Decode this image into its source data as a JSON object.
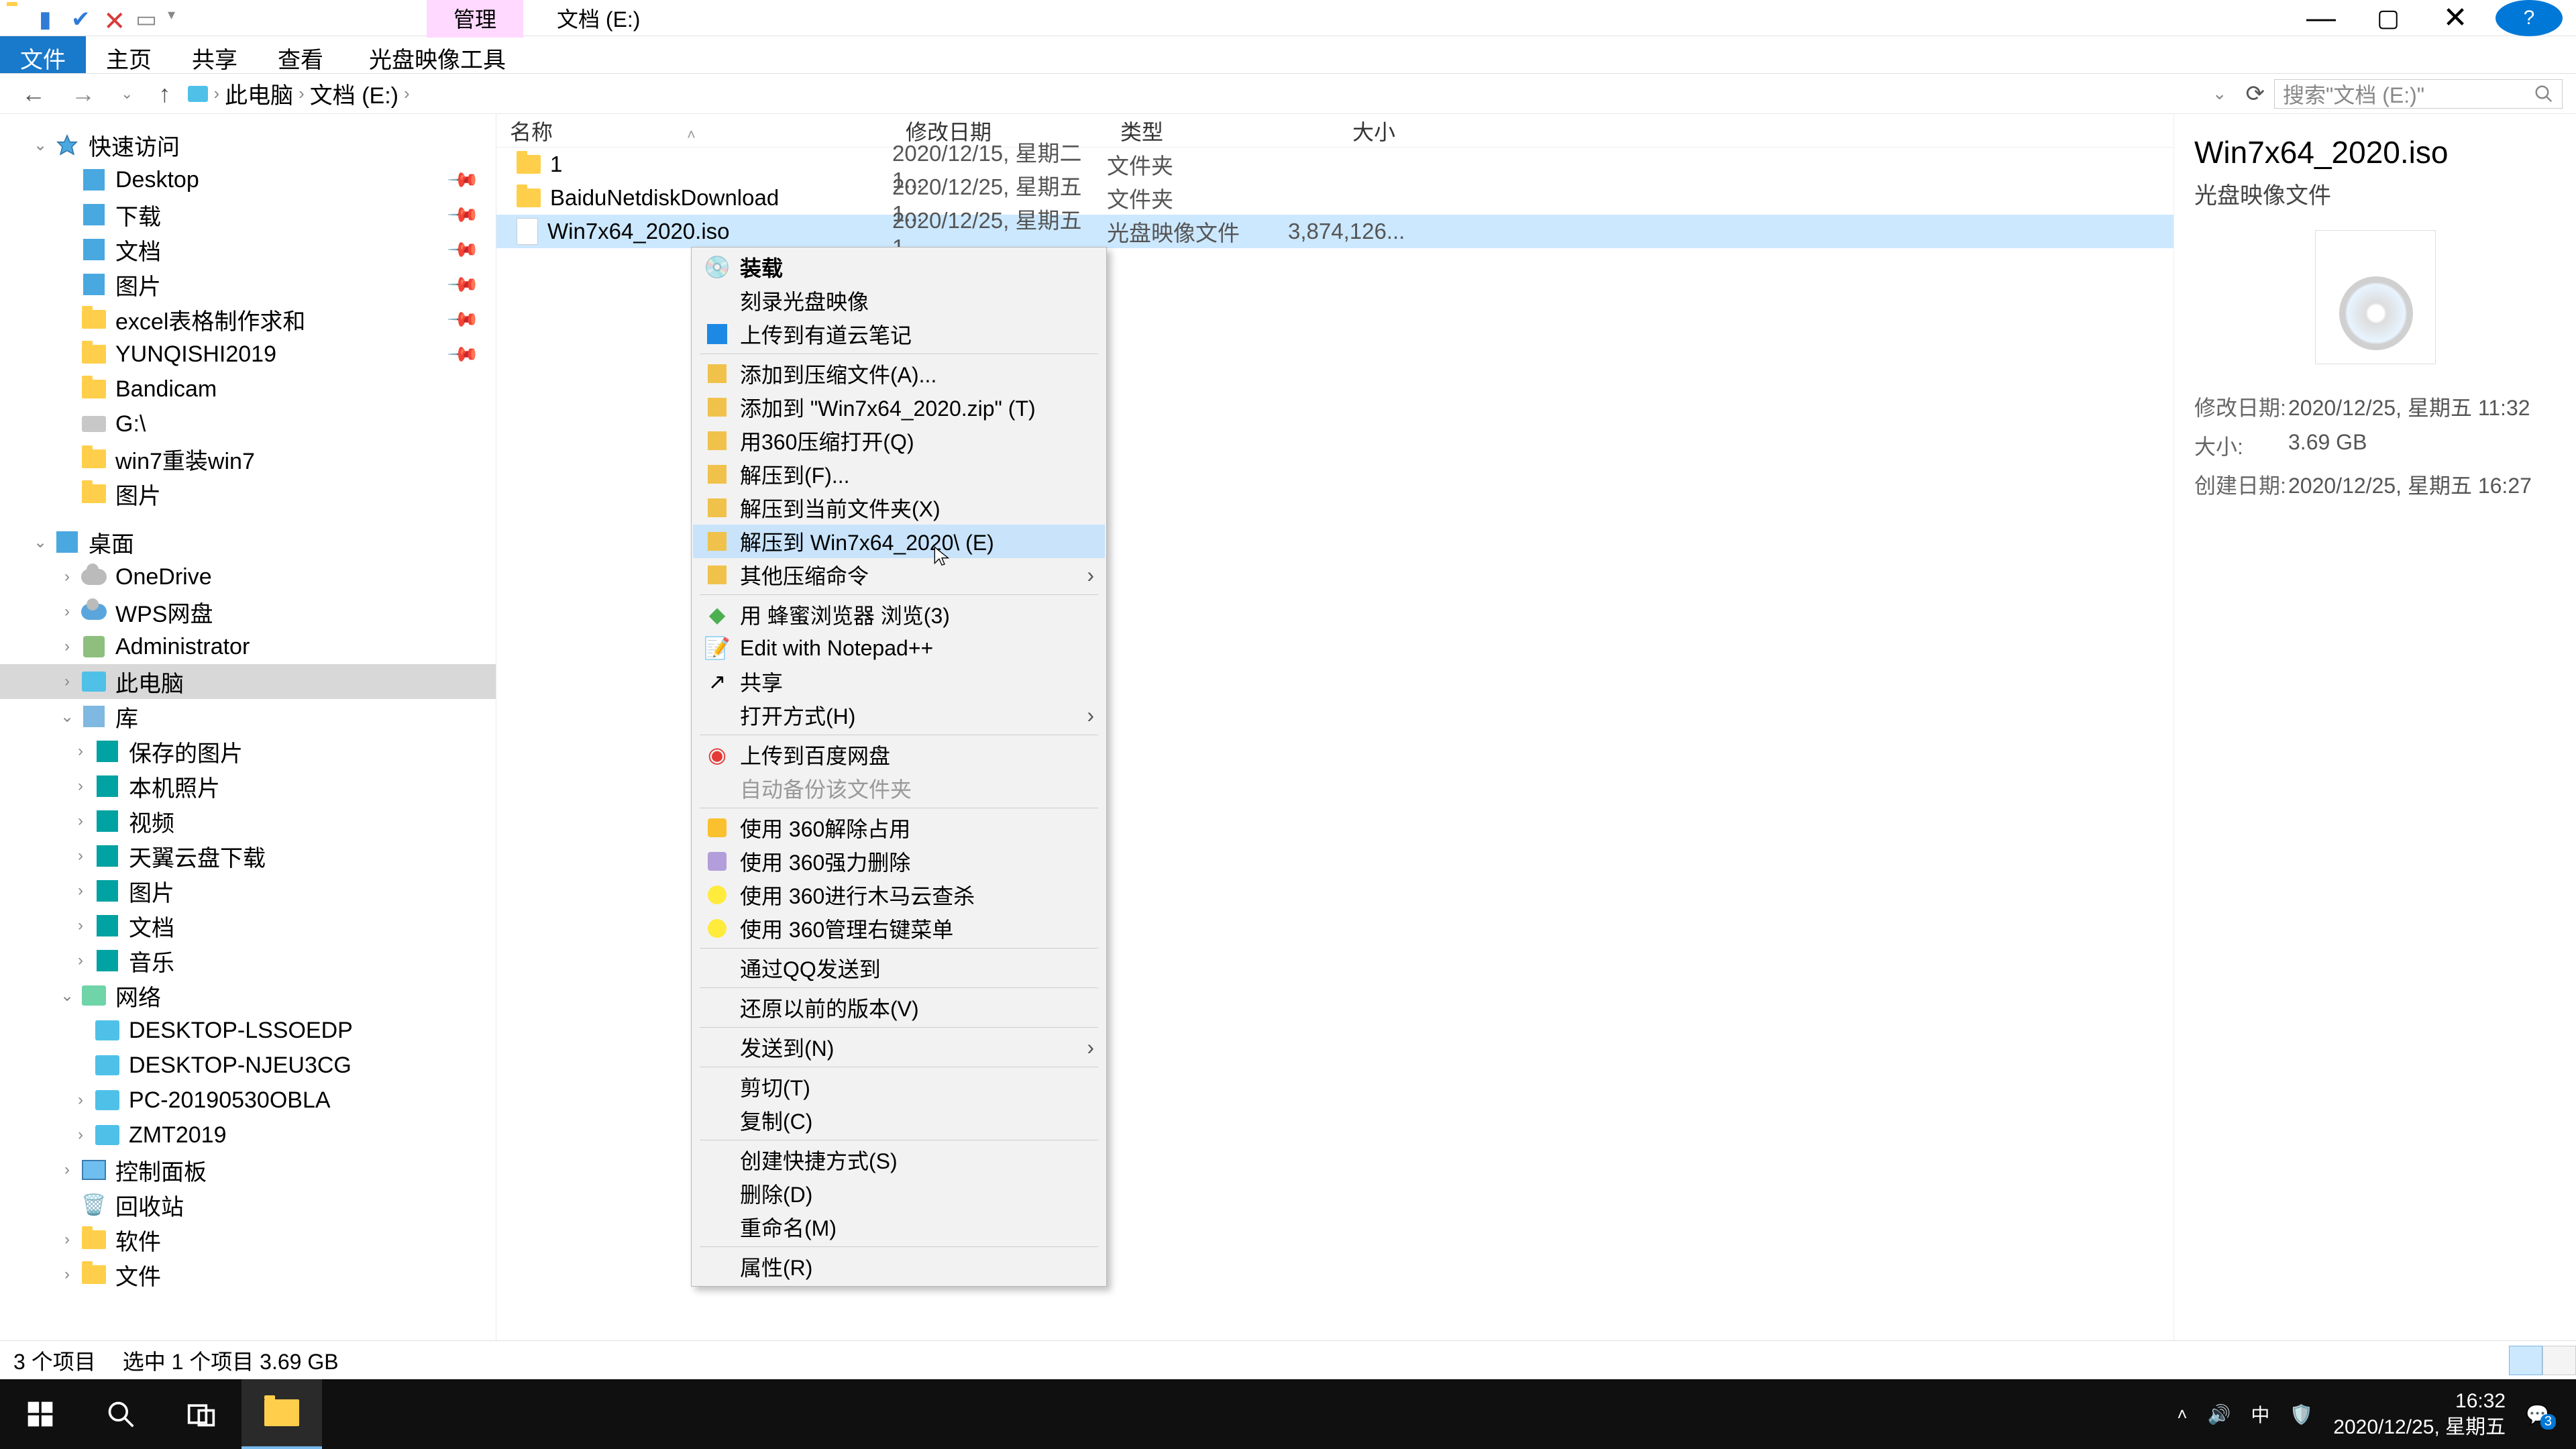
{
  "titlebar": {
    "contextual_tab": "管理",
    "title": "文档 (E:)"
  },
  "ribbon": {
    "file": "文件",
    "home": "主页",
    "share": "共享",
    "view": "查看",
    "iso_tools": "光盘映像工具"
  },
  "address": {
    "root": "此电脑",
    "loc": "文档 (E:)",
    "search_placeholder": "搜索\"文档 (E:)\""
  },
  "tree": {
    "quick": "快速访问",
    "desktop": "Desktop",
    "downloads": "下载",
    "documents": "文档",
    "pictures": "图片",
    "excel": "excel表格制作求和",
    "yunqishi": "YUNQISHI2019",
    "bandicam": "Bandicam",
    "g_drive": "G:\\",
    "win7reinstall": "win7重装win7",
    "pictures2": "图片",
    "desktop_zh": "桌面",
    "onedrive": "OneDrive",
    "wps": "WPS网盘",
    "admin": "Administrator",
    "thispc": "此电脑",
    "libs": "库",
    "saved_pics": "保存的图片",
    "local_photos": "本机照片",
    "videos": "视频",
    "tianyi": "天翼云盘下载",
    "pics_lib": "图片",
    "docs_lib": "文档",
    "music_lib": "音乐",
    "network": "网络",
    "net1": "DESKTOP-LSSOEDP",
    "net2": "DESKTOP-NJEU3CG",
    "net3": "PC-20190530OBLA",
    "net4": "ZMT2019",
    "cpanel": "控制面板",
    "recycle": "回收站",
    "soft": "软件",
    "files": "文件"
  },
  "columns": {
    "name": "名称",
    "date": "修改日期",
    "type": "类型",
    "size": "大小"
  },
  "files": [
    {
      "name": "1",
      "date": "2020/12/15, 星期二 1...",
      "type": "文件夹",
      "size": ""
    },
    {
      "name": "BaiduNetdiskDownload",
      "date": "2020/12/25, 星期五 1...",
      "type": "文件夹",
      "size": ""
    },
    {
      "name": "Win7x64_2020.iso",
      "date": "2020/12/25, 星期五 1...",
      "type": "光盘映像文件",
      "size": "3,874,126..."
    }
  ],
  "ctx": {
    "mount": "装载",
    "burn": "刻录光盘映像",
    "youdao": "上传到有道云笔记",
    "add_archive": "添加到压缩文件(A)...",
    "add_zip": "添加到 \"Win7x64_2020.zip\" (T)",
    "open360": "用360压缩打开(Q)",
    "extract_to": "解压到(F)...",
    "extract_here": "解压到当前文件夹(X)",
    "extract_named": "解压到 Win7x64_2020\\ (E)",
    "other_compress": "其他压缩命令",
    "fengmi": "用 蜂蜜浏览器 浏览(3)",
    "npp": "Edit with Notepad++",
    "share": "共享",
    "openwith": "打开方式(H)",
    "baidu_upload": "上传到百度网盘",
    "auto_backup": "自动备份该文件夹",
    "use360_unlock": "使用 360解除占用",
    "use360_force_del": "使用 360强力删除",
    "use360_trojan": "使用 360进行木马云查杀",
    "use360_menu": "使用 360管理右键菜单",
    "qq_send": "通过QQ发送到",
    "restore_prev": "还原以前的版本(V)",
    "send_to": "发送到(N)",
    "cut": "剪切(T)",
    "copy": "复制(C)",
    "shortcut": "创建快捷方式(S)",
    "delete": "删除(D)",
    "rename": "重命名(M)",
    "properties": "属性(R)"
  },
  "details": {
    "name": "Win7x64_2020.iso",
    "type": "光盘映像文件",
    "mod_label": "修改日期:",
    "mod_val": "2020/12/25, 星期五 11:32",
    "size_label": "大小:",
    "size_val": "3.69 GB",
    "created_label": "创建日期:",
    "created_val": "2020/12/25, 星期五 16:27"
  },
  "status": {
    "count": "3 个项目",
    "selected": "选中 1 个项目  3.69 GB"
  },
  "taskbar": {
    "ime": "中",
    "time": "16:32",
    "date": "2020/12/25, 星期五",
    "badge": "3"
  }
}
